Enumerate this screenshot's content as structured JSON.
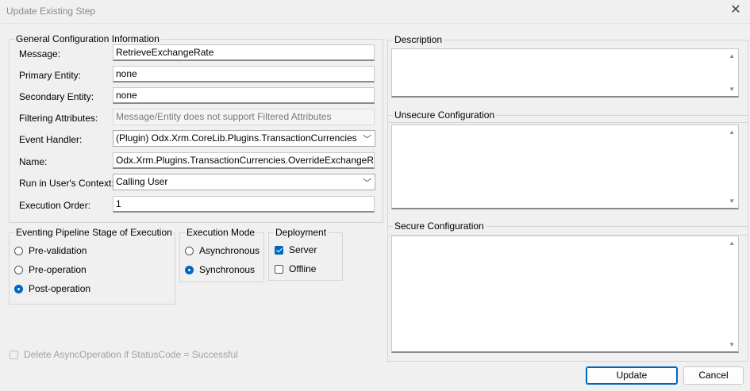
{
  "window": {
    "title": "Update Existing Step"
  },
  "general": {
    "legend": "General Configuration Information",
    "message_label": "Message:",
    "message_value": "RetrieveExchangeRate",
    "primary_label": "Primary Entity:",
    "primary_value": "none",
    "secondary_label": "Secondary Entity:",
    "secondary_value": "none",
    "filtering_label": "Filtering Attributes:",
    "filtering_value": "Message/Entity does not support Filtered Attributes",
    "handler_label": "Event Handler:",
    "handler_value": "(Plugin) Odx.Xrm.CoreLib.Plugins.TransactionCurrencies.Overri",
    "name_label": "Name:",
    "name_value": "Odx.Xrm.Plugins.TransactionCurrencies.OverrideExchangeRate: A",
    "context_label": "Run in User's Context:",
    "context_value": "Calling User",
    "order_label": "Execution Order:",
    "order_value": "1"
  },
  "stage": {
    "legend": "Eventing Pipeline Stage of Execution",
    "options": [
      "Pre-validation",
      "Pre-operation",
      "Post-operation"
    ],
    "selected": "Post-operation"
  },
  "mode": {
    "legend": "Execution Mode",
    "options": [
      "Asynchronous",
      "Synchronous"
    ],
    "selected": "Synchronous"
  },
  "deployment": {
    "legend": "Deployment",
    "server_label": "Server",
    "server_checked": true,
    "offline_label": "Offline",
    "offline_checked": false
  },
  "delete_async_label": "Delete AsyncOperation if StatusCode = Successful",
  "description": {
    "legend": "Description"
  },
  "unsecure": {
    "legend": "Unsecure Configuration"
  },
  "secure": {
    "legend": "Secure Configuration"
  },
  "buttons": {
    "update": "Update",
    "cancel": "Cancel"
  },
  "icons": {
    "close": "close-icon",
    "chevron": "chevron-down-icon",
    "scroll_up": "scroll-up-icon",
    "scroll_down": "scroll-down-icon"
  },
  "colors": {
    "accent": "#0067c0"
  }
}
